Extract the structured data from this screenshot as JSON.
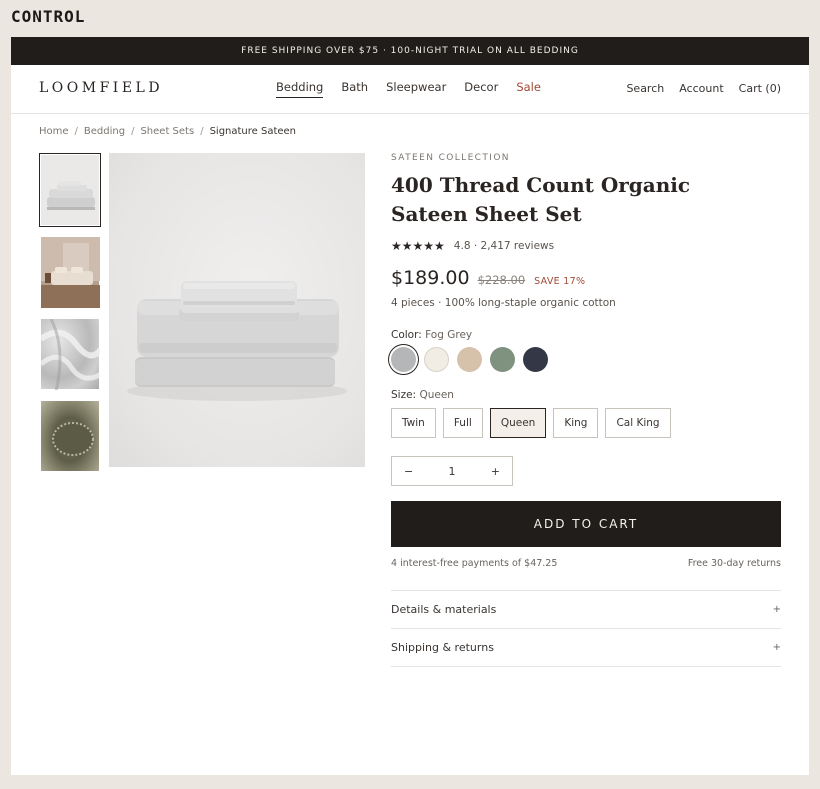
{
  "control_label": "CONTROL",
  "promo": {
    "text": "FREE SHIPPING OVER $75 · 100-NIGHT TRIAL ON ALL BEDDING"
  },
  "header": {
    "logo": "LOOMFIELD",
    "nav": [
      {
        "label": "Bedding",
        "active": true
      },
      {
        "label": "Bath"
      },
      {
        "label": "Sleepwear"
      },
      {
        "label": "Decor"
      },
      {
        "label": "Sale"
      }
    ],
    "utility": {
      "search": "Search",
      "account": "Account",
      "cart": "Cart (0)"
    }
  },
  "breadcrumb": [
    {
      "label": "Home"
    },
    {
      "label": "Bedding"
    },
    {
      "label": "Sheet Sets"
    },
    {
      "label": "Signature Sateen"
    }
  ],
  "breadcrumb_separator": "/",
  "gallery": {
    "thumbnails": [
      {
        "icon": "folded-sheets-thumbnail",
        "active": true
      },
      {
        "icon": "bedroom-thumbnail"
      },
      {
        "icon": "fabric-drape-thumbnail"
      },
      {
        "icon": "fitted-sheet-thumbnail"
      }
    ],
    "main_image_icon": "folded-sheet-set-image"
  },
  "product": {
    "collection": "SATEEN COLLECTION",
    "title": "400 Thread Count Organic Sateen Sheet Set",
    "stars": "★★★★★",
    "rating_text": "4.8 · 2,417 reviews",
    "price": "$189.00",
    "compare_price": "$228.00",
    "save": "SAVE 17%",
    "subline": "4 pieces · 100% long-staple organic cotton",
    "color_label": "Color:",
    "color_value": "Fog Grey",
    "colors": [
      {
        "hex": "#b4b6b7",
        "selected": true
      },
      {
        "hex": "#f1ece4"
      },
      {
        "hex": "#d6c1ab"
      },
      {
        "hex": "#7f917f"
      },
      {
        "hex": "#343846"
      }
    ],
    "size_label": "Size:",
    "size_value": "Queen",
    "sizes": [
      {
        "label": "Twin"
      },
      {
        "label": "Full"
      },
      {
        "label": "Queen",
        "selected": true
      },
      {
        "label": "King"
      },
      {
        "label": "Cal King"
      }
    ],
    "quantity": {
      "minus": "−",
      "value": "1",
      "plus": "+"
    },
    "add_to_cart": "ADD TO CART",
    "installments": "4 interest-free payments of $47.25",
    "returns": "Free 30-day returns",
    "accordions": [
      {
        "label": "Details & materials",
        "icon": "+"
      },
      {
        "label": "Shipping & returns",
        "icon": "+"
      }
    ]
  }
}
